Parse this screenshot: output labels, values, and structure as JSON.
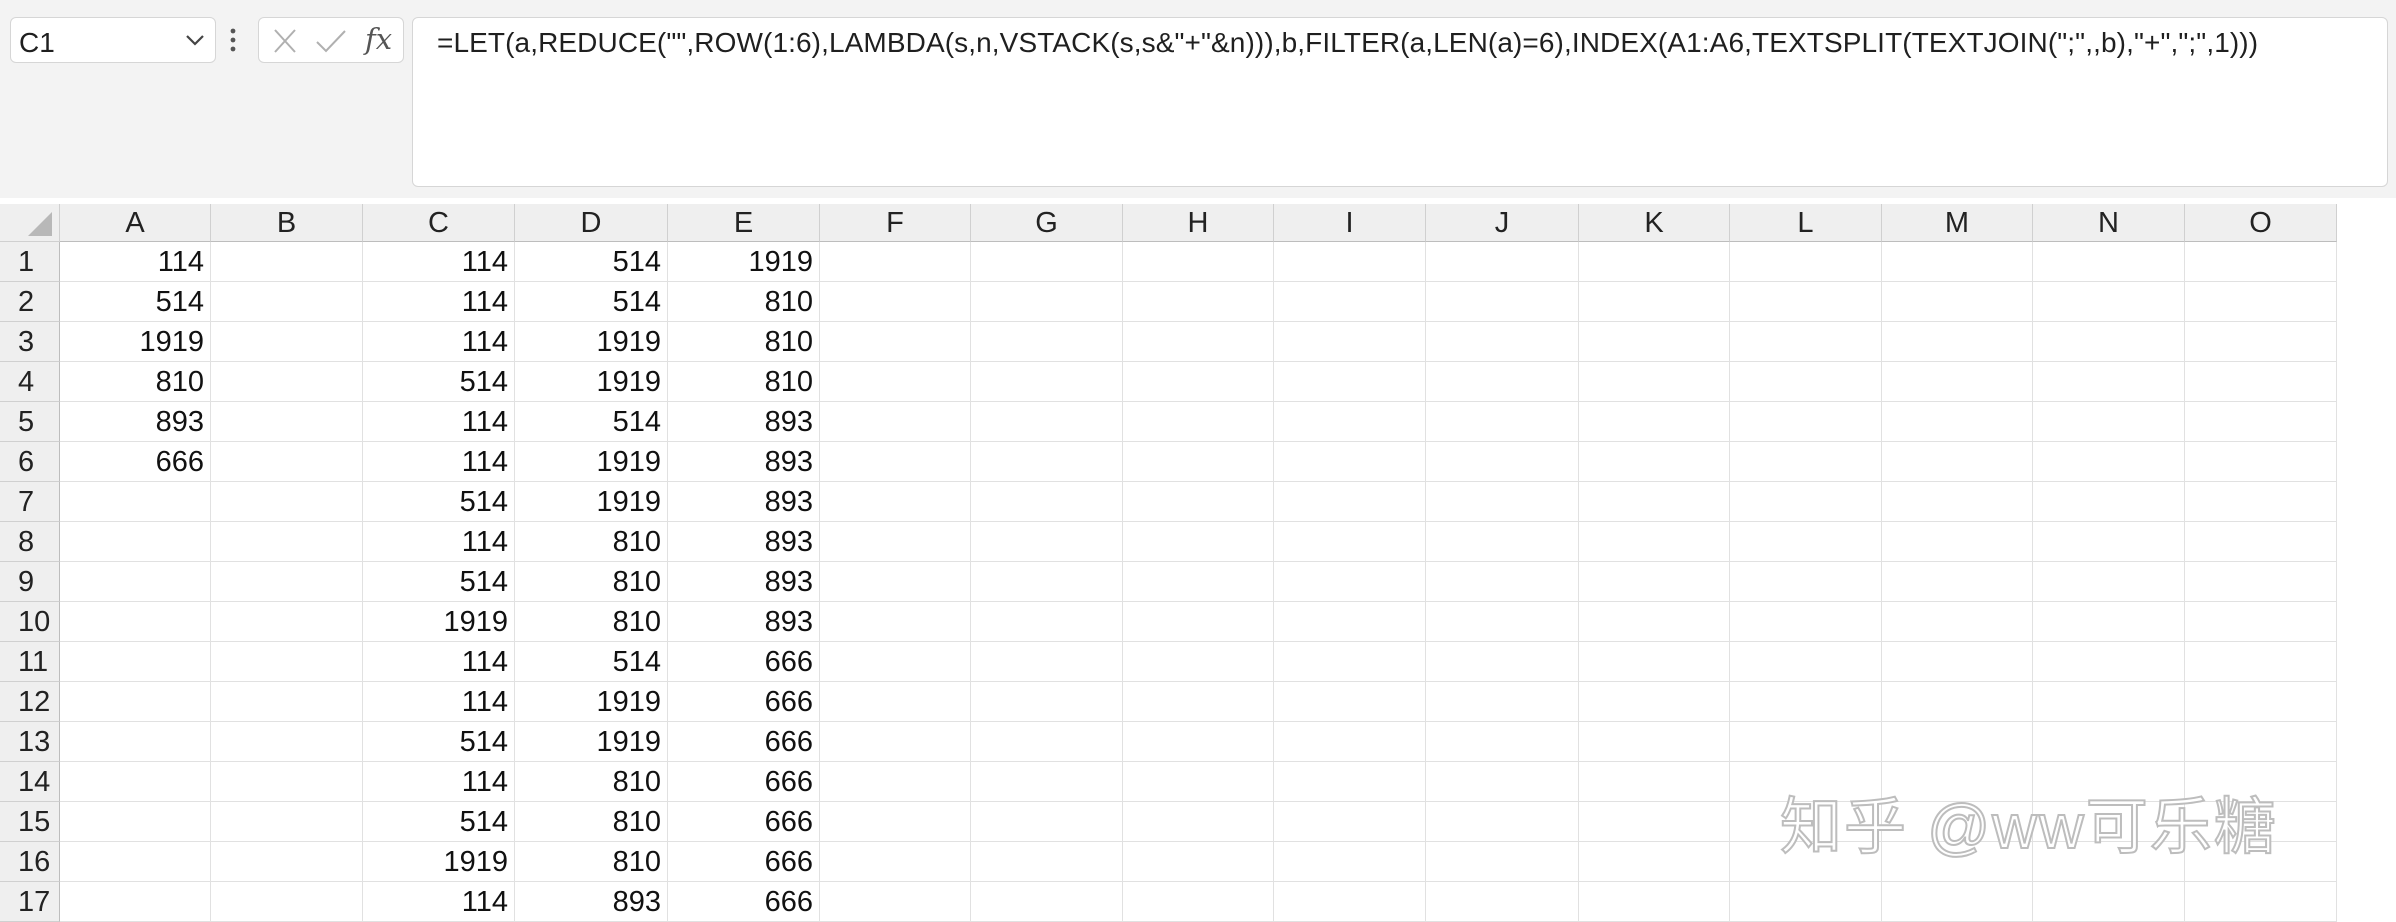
{
  "name_box": {
    "value": "C1"
  },
  "formula_bar": {
    "fx_label": "fx",
    "formula": "=LET(a,REDUCE(\"\",ROW(1:6),LAMBDA(s,n,VSTACK(s,s&\"+\"&n))),b,FILTER(a,LEN(a)=6),INDEX(A1:A6,TEXTSPLIT(TEXTJOIN(\";\",,b),\"+\",\";\",1)))"
  },
  "icons": {
    "name_box_dropdown": "chevron-down-icon",
    "more_options": "vertical-ellipsis-icon",
    "cancel": "close-icon",
    "enter": "check-icon"
  },
  "columns": [
    "A",
    "B",
    "C",
    "D",
    "E",
    "F",
    "G",
    "H",
    "I",
    "J",
    "K",
    "L",
    "M",
    "N",
    "O"
  ],
  "rows": [
    {
      "num": "1",
      "A": "114",
      "C": "114",
      "D": "514",
      "E": "1919"
    },
    {
      "num": "2",
      "A": "514",
      "C": "114",
      "D": "514",
      "E": "810"
    },
    {
      "num": "3",
      "A": "1919",
      "C": "114",
      "D": "1919",
      "E": "810"
    },
    {
      "num": "4",
      "A": "810",
      "C": "514",
      "D": "1919",
      "E": "810"
    },
    {
      "num": "5",
      "A": "893",
      "C": "114",
      "D": "514",
      "E": "893"
    },
    {
      "num": "6",
      "A": "666",
      "C": "114",
      "D": "1919",
      "E": "893"
    },
    {
      "num": "7",
      "C": "514",
      "D": "1919",
      "E": "893"
    },
    {
      "num": "8",
      "C": "114",
      "D": "810",
      "E": "893"
    },
    {
      "num": "9",
      "C": "514",
      "D": "810",
      "E": "893"
    },
    {
      "num": "10",
      "C": "1919",
      "D": "810",
      "E": "893"
    },
    {
      "num": "11",
      "C": "114",
      "D": "514",
      "E": "666"
    },
    {
      "num": "12",
      "C": "114",
      "D": "1919",
      "E": "666"
    },
    {
      "num": "13",
      "C": "514",
      "D": "1919",
      "E": "666"
    },
    {
      "num": "14",
      "C": "114",
      "D": "810",
      "E": "666"
    },
    {
      "num": "15",
      "C": "514",
      "D": "810",
      "E": "666"
    },
    {
      "num": "16",
      "C": "1919",
      "D": "810",
      "E": "666"
    },
    {
      "num": "17",
      "C": "114",
      "D": "893",
      "E": "666"
    }
  ],
  "watermark": "知乎 @ww可乐糖"
}
